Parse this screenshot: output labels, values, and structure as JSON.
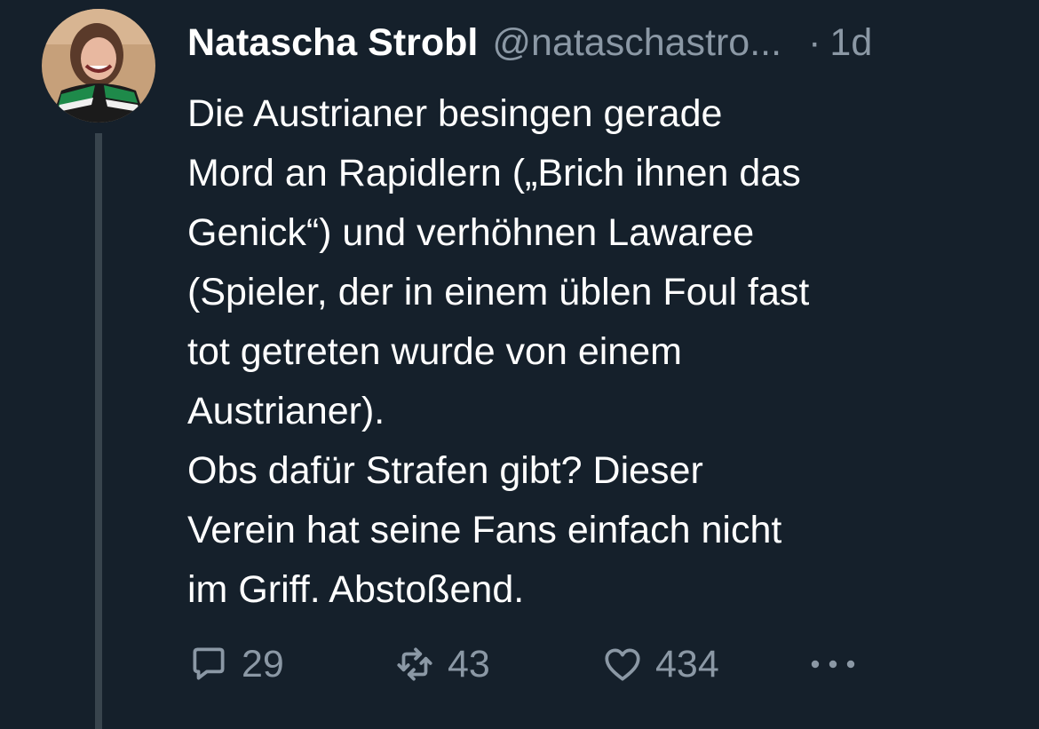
{
  "tweet": {
    "display_name": "Natascha Strobl",
    "handle": "@nataschastro...",
    "separator": "·",
    "time": "1d",
    "lines": [
      "Die Austrianer besingen gerade",
      "Mord an Rapidlern („Brich ihnen das",
      "Genick“) und verhöhnen Lawaree",
      "(Spieler, der in einem üblen Foul fast",
      "tot getreten wurde von einem",
      "Austrianer).",
      "Obs dafür Strafen gibt? Dieser",
      "Verein hat seine Fans einfach nicht",
      "im Griff. Abstoßend."
    ]
  },
  "actions": {
    "reply_count": "29",
    "retweet_count": "43",
    "like_count": "434",
    "reply_icon": "reply-icon",
    "retweet_icon": "retweet-icon",
    "like_icon": "heart-icon",
    "more_icon": "more-icon"
  },
  "colors": {
    "background": "#15202b",
    "text_primary": "#ffffff",
    "text_secondary": "#8b98a5",
    "thread_line": "#38444d"
  }
}
